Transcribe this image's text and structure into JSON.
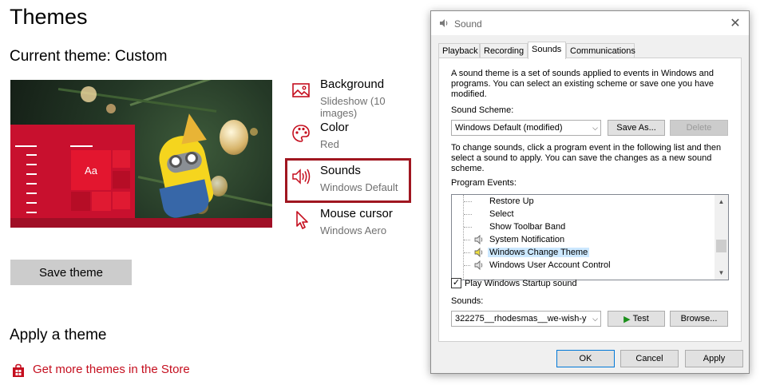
{
  "settings": {
    "page_title": "Themes",
    "current_theme_label": "Current theme: Custom",
    "preview_tile_text": "Aa",
    "items": [
      {
        "label": "Background",
        "value": "Slideshow (10 images)",
        "icon": "picture-icon"
      },
      {
        "label": "Color",
        "value": "Red",
        "icon": "palette-icon"
      },
      {
        "label": "Sounds",
        "value": "Windows Default",
        "icon": "speaker-icon"
      },
      {
        "label": "Mouse cursor",
        "value": "Windows Aero",
        "icon": "cursor-icon"
      }
    ],
    "save_theme_label": "Save theme",
    "apply_heading": "Apply a theme",
    "store_link_label": "Get more themes in the Store",
    "accent_color": "#c50f1f",
    "highlight_color": "#a01620"
  },
  "dialog": {
    "title": "Sound",
    "close_glyph": "✕",
    "tabs": [
      {
        "label": "Playback",
        "active": false
      },
      {
        "label": "Recording",
        "active": false
      },
      {
        "label": "Sounds",
        "active": true
      },
      {
        "label": "Communications",
        "active": false
      }
    ],
    "intro_text": "A sound theme is a set of sounds applied to events in Windows and programs.  You can select an existing scheme or save one you have modified.",
    "scheme_label": "Sound Scheme:",
    "scheme_value": "Windows Default (modified)",
    "save_as_label": "Save As...",
    "delete_label": "Delete",
    "instructions_text": "To change sounds, click a program event in the following list and then select a sound to apply.  You can save the changes as a new sound scheme.",
    "events_label": "Program Events:",
    "events": [
      {
        "name": "Restore Up",
        "has_sound": false,
        "selected": false
      },
      {
        "name": "Select",
        "has_sound": false,
        "selected": false
      },
      {
        "name": "Show Toolbar Band",
        "has_sound": false,
        "selected": false
      },
      {
        "name": "System Notification",
        "has_sound": true,
        "selected": false
      },
      {
        "name": "Windows Change Theme",
        "has_sound": true,
        "selected": true
      },
      {
        "name": "Windows User Account Control",
        "has_sound": true,
        "selected": false
      }
    ],
    "startup_sound_label": "Play Windows Startup sound",
    "startup_sound_checked": true,
    "sounds_label": "Sounds:",
    "sound_value": "322275__rhodesmas__we-wish-y",
    "test_label": "Test",
    "browse_label": "Browse...",
    "ok_label": "OK",
    "cancel_label": "Cancel",
    "apply_label": "Apply"
  }
}
